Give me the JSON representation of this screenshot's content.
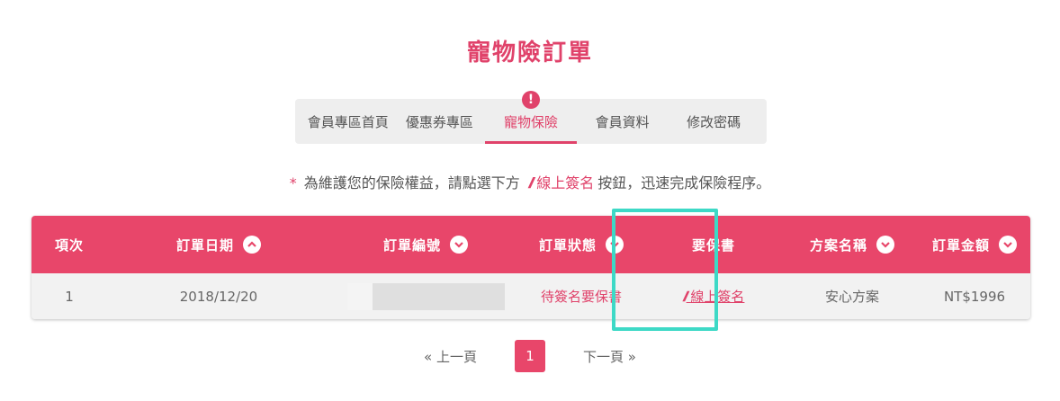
{
  "page": {
    "title": "寵物險訂單"
  },
  "tabs": [
    {
      "label": "會員專區首頁",
      "active": false
    },
    {
      "label": "優惠券專區",
      "active": false
    },
    {
      "label": "寵物保險",
      "active": true,
      "badge": "!"
    },
    {
      "label": "會員資料",
      "active": false
    },
    {
      "label": "修改密碼",
      "active": false
    }
  ],
  "notice": {
    "star": "*",
    "before": "為維護您的保險權益，請點選下方",
    "link": "線上簽名",
    "after": "按鈕，迅速完成保險程序。"
  },
  "table": {
    "headers": [
      "項次",
      "訂單日期",
      "訂單編號",
      "訂單狀態",
      "要保書",
      "方案名稱",
      "訂單金額"
    ],
    "rows": [
      {
        "index": "1",
        "date": "2018/12/20",
        "order_no": "",
        "status": "待簽名要保書",
        "sign": "線上簽名",
        "plan": "安心方案",
        "amount": "NT$1996"
      }
    ]
  },
  "pagination": {
    "prev": "« 上一頁",
    "current": "1",
    "next": "下一頁 »"
  },
  "colors": {
    "accent": "#e8466a",
    "highlight": "#3dd9c6"
  }
}
